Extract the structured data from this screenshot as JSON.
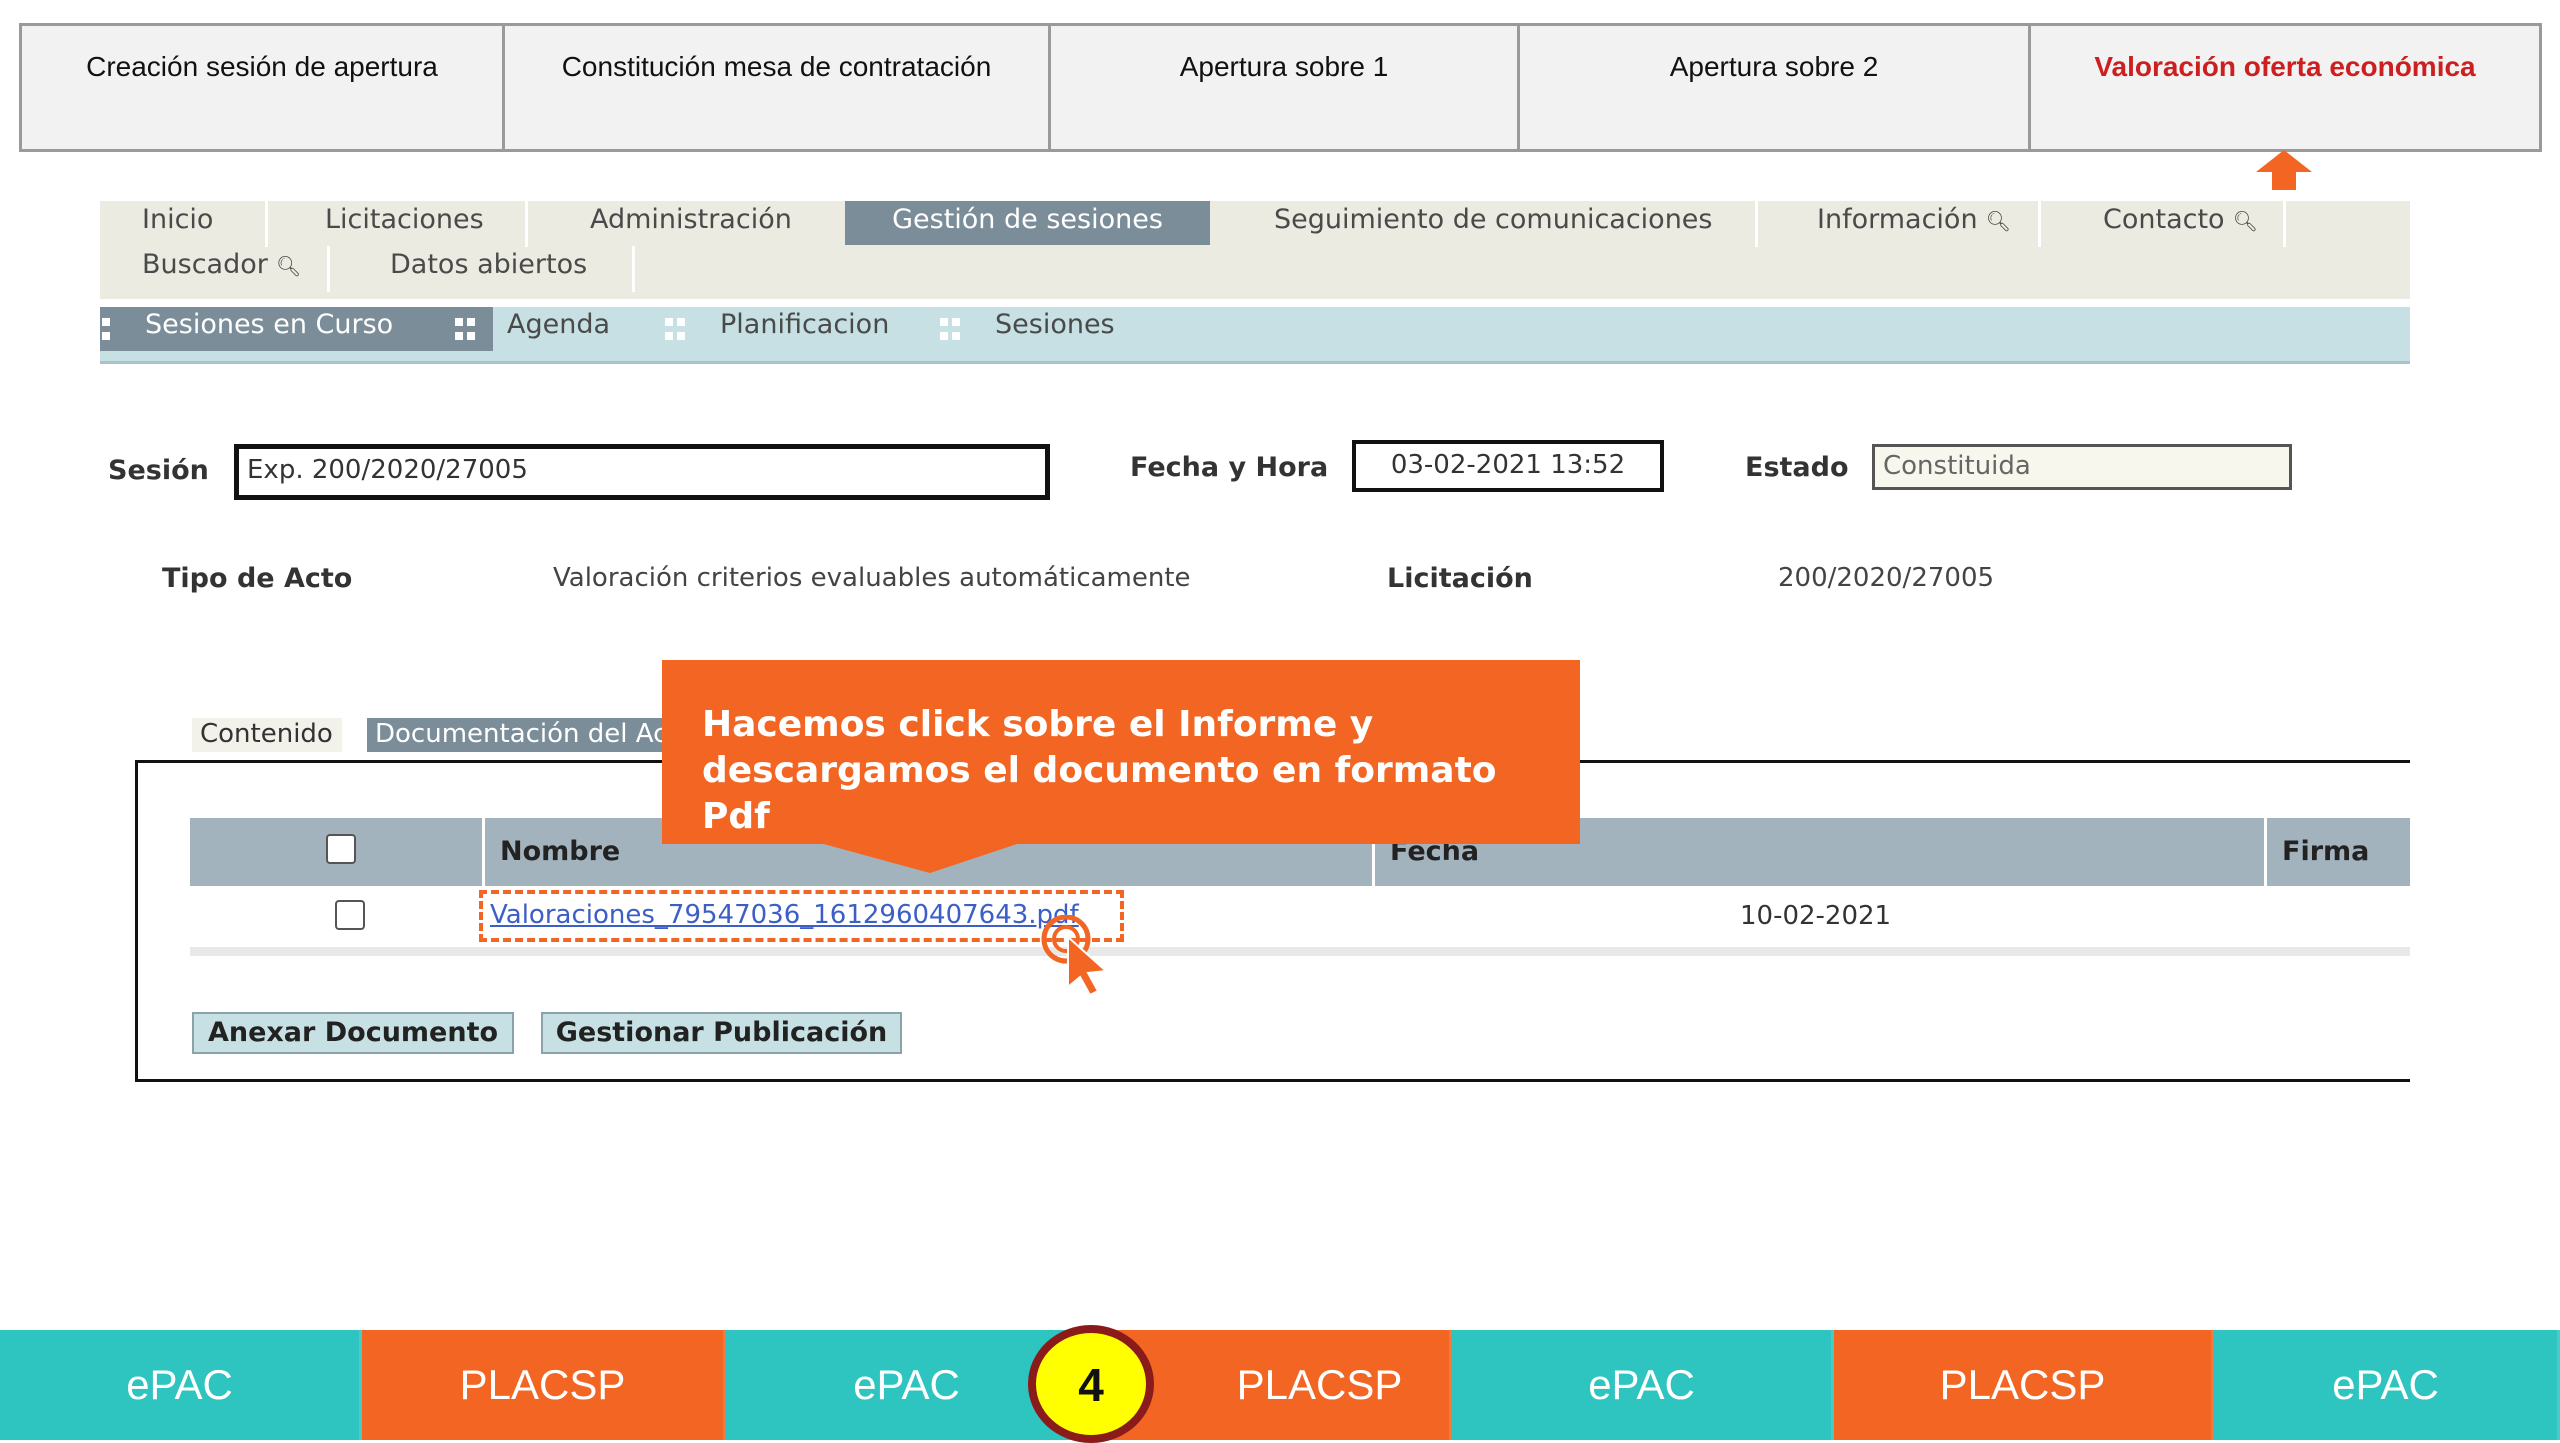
{
  "steps": [
    {
      "label": "Creación sesión de apertura"
    },
    {
      "label": "Constitución mesa de contratación"
    },
    {
      "label": "Apertura sobre 1"
    },
    {
      "label": "Apertura sobre 2"
    },
    {
      "label": "Valoración oferta económica"
    }
  ],
  "colors": {
    "accent": "#f26522",
    "active_step": "#cc1f1f",
    "teal": "#2ec4bf",
    "nav_active": "#7b8d99"
  },
  "main_nav": {
    "inicio": "Inicio",
    "licitaciones": "Licitaciones",
    "administracion": "Administración",
    "gestion": "Gestión de sesiones",
    "seguimiento": "Seguimiento de comunicaciones",
    "informacion": "Información",
    "contacto": "Contacto",
    "buscador": "Buscador",
    "datos_abiertos": "Datos abiertos"
  },
  "sub_nav": {
    "sesiones_curso": "Sesiones en Curso",
    "agenda": "Agenda",
    "planificacion": "Planificacion",
    "sesiones": "Sesiones"
  },
  "session": {
    "sesion_label": "Sesión",
    "sesion_value": "Exp. 200/2020/27005",
    "fecha_label": "Fecha y Hora",
    "fecha_value": "03-02-2021 13:52",
    "estado_label": "Estado",
    "estado_value": "Constituida",
    "tipo_label": "Tipo de Acto",
    "tipo_value": "Valoración criterios evaluables automáticamente",
    "licitacion_label": "Licitación",
    "licitacion_value": "200/2020/27005"
  },
  "tabs": {
    "contenido": "Contenido",
    "documentacion": "Documentación del Acto"
  },
  "table": {
    "headers": {
      "nombre": "Nombre",
      "fecha": "Fecha",
      "firma": "Firma"
    },
    "rows": [
      {
        "nombre": "Valoraciones_79547036_1612960407643.pdf",
        "fecha": "10-02-2021",
        "firma": ""
      }
    ]
  },
  "buttons": {
    "anexar": "Anexar Documento",
    "gestionar": "Gestionar Publicación"
  },
  "callout": {
    "text": "Hacemos click sobre el Informe y descargamos el documento en formato Pdf"
  },
  "bottom_bar": [
    {
      "label": "ePAC",
      "color": "teal"
    },
    {
      "label": "PLACSP",
      "color": "orange"
    },
    {
      "label": "ePAC",
      "color": "teal"
    },
    {
      "label": "PLACSP",
      "color": "orange"
    },
    {
      "label": "ePAC",
      "color": "teal"
    },
    {
      "label": "PLACSP",
      "color": "orange"
    },
    {
      "label": "ePAC",
      "color": "teal"
    }
  ],
  "step_badge": "4",
  "icons": {
    "search": "magnifier-icon",
    "cursor": "hand-pointer-icon",
    "arrow": "up-arrow-icon"
  }
}
